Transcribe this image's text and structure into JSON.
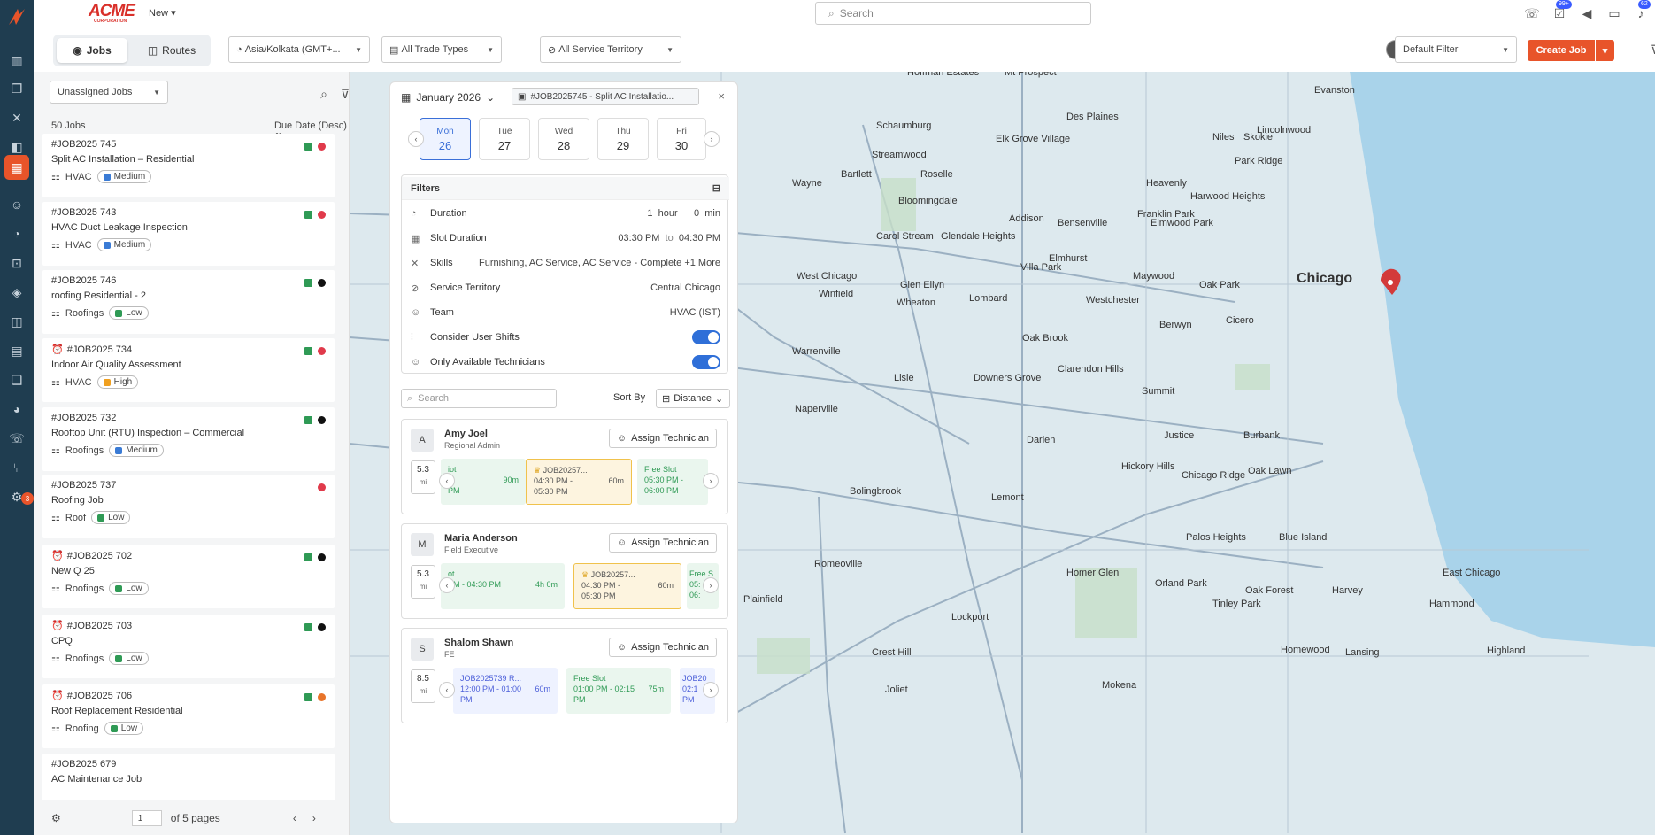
{
  "header": {
    "brand": "ACME",
    "brand_sub": "CORPORATION",
    "new_label": "New",
    "search_placeholder": "Search",
    "badges": {
      "tasks": "99+",
      "notif": "62"
    }
  },
  "toolbar": {
    "tab_jobs": "Jobs",
    "tab_routes": "Routes",
    "timezone": "Asia/Kolkata (GMT+...",
    "trade_types": "All Trade Types",
    "territory": "All Service Territory",
    "filter": "Default Filter",
    "create_job": "Create Job"
  },
  "sidebar_badge": "3",
  "jobs": {
    "selector": "Unassigned Jobs",
    "count": "50 Jobs",
    "sort": "Due Date (Desc)",
    "items": [
      {
        "id": "#JOB2025 745",
        "title": "Split AC Installation – Residential",
        "trade": "HVAC",
        "priority": "Medium",
        "pcolor": "#3a7bd5",
        "alarm": false,
        "d1": "#2f9a55",
        "d2": "#e03a4b"
      },
      {
        "id": "#JOB2025 743",
        "title": "HVAC Duct Leakage Inspection",
        "trade": "HVAC",
        "priority": "Medium",
        "pcolor": "#3a7bd5",
        "alarm": false,
        "d1": "#2f9a55",
        "d2": "#e03a4b"
      },
      {
        "id": "#JOB2025 746",
        "title": "roofing Residential - 2",
        "trade": "Roofings",
        "priority": "Low",
        "pcolor": "#2f9a55",
        "alarm": false,
        "d1": "#2f9a55",
        "d2": "#111"
      },
      {
        "id": "#JOB2025 734",
        "title": "Indoor Air Quality Assessment",
        "trade": "HVAC",
        "priority": "High",
        "pcolor": "#f0a020",
        "alarm": true,
        "d1": "#2f9a55",
        "d2": "#e03a4b"
      },
      {
        "id": "#JOB2025 732",
        "title": "Rooftop Unit (RTU) Inspection – Commercial",
        "trade": "Roofings",
        "priority": "Medium",
        "pcolor": "#3a7bd5",
        "alarm": false,
        "d1": "#2f9a55",
        "d2": "#111"
      },
      {
        "id": "#JOB2025 737",
        "title": "Roofing Job",
        "trade": "Roof",
        "priority": "Low",
        "pcolor": "#2f9a55",
        "alarm": false,
        "d1": "",
        "d2": "#e03a4b"
      },
      {
        "id": "#JOB2025 702",
        "title": "New Q 25",
        "trade": "Roofings",
        "priority": "Low",
        "pcolor": "#2f9a55",
        "alarm": true,
        "d1": "#2f9a55",
        "d2": "#111"
      },
      {
        "id": "#JOB2025 703",
        "title": "CPQ",
        "trade": "Roofings",
        "priority": "Low",
        "pcolor": "#2f9a55",
        "alarm": true,
        "d1": "#2f9a55",
        "d2": "#111"
      },
      {
        "id": "#JOB2025 706",
        "title": "Roof Replacement Residential",
        "trade": "Roofing",
        "priority": "Low",
        "pcolor": "#2f9a55",
        "alarm": true,
        "d1": "#2f9a55",
        "d2": "#e8742a"
      },
      {
        "id": "#JOB2025 679",
        "title": "AC Maintenance Job",
        "trade": "",
        "priority": "",
        "pcolor": "",
        "alarm": false,
        "d1": "",
        "d2": ""
      }
    ],
    "page": "1",
    "pages_label": "of 5 pages"
  },
  "panel": {
    "month": "January 2026",
    "job_chip": "#JOB2025745 - Split AC Installatio...",
    "days": [
      {
        "d": "Mon",
        "n": "26"
      },
      {
        "d": "Tue",
        "n": "27"
      },
      {
        "d": "Wed",
        "n": "28"
      },
      {
        "d": "Thu",
        "n": "29"
      },
      {
        "d": "Fri",
        "n": "30"
      }
    ],
    "filters_title": "Filters",
    "duration_label": "Duration",
    "duration_h": "1",
    "hour": "hour",
    "duration_m": "0",
    "min": "min",
    "slot_label": "Slot Duration",
    "slot_from": "03:30 PM",
    "to": "to",
    "slot_to": "04:30 PM",
    "skills_label": "Skills",
    "skills": "Furnishing, AC Service, AC Service - Complete +1 More",
    "territory_label": "Service Territory",
    "territory": "Central Chicago",
    "team_label": "Team",
    "team": "HVAC (IST)",
    "shifts_label": "Consider User Shifts",
    "avail_label": "Only Available Technicians",
    "search_placeholder": "Search",
    "sortby": "Sort By",
    "sort_value": "Distance",
    "assign": "Assign Technician",
    "techs": [
      {
        "ini": "A",
        "name": "Amy Joel",
        "role": "Regional Admin",
        "dist": "5.3",
        "unit": "mi"
      },
      {
        "ini": "M",
        "name": "Maria Anderson",
        "role": "Field Executive",
        "dist": "5.3",
        "unit": "mi"
      },
      {
        "ini": "S",
        "name": "Shalom Shawn",
        "role": "FE",
        "dist": "8.5",
        "unit": "mi"
      }
    ]
  },
  "map": {
    "labels": [
      "Evanston",
      "Skokie",
      "Niles",
      "Des Plaines",
      "Mt Prospect",
      "Hoffman Estates",
      "Schaumburg",
      "Elk Grove Village",
      "Park Ridge",
      "Lincolnwood",
      "Streamwood",
      "Bartlett",
      "Roselle",
      "Wayne",
      "Bloomingdale",
      "Addison",
      "Bensenville",
      "Franklin Park",
      "Elmwood Park",
      "Heavenly",
      "Harwood Heights",
      "Carol Stream",
      "Glendale Heights",
      "Elmhurst",
      "Maywood",
      "Oak Park",
      "Chicago",
      "West Chicago",
      "Winfield",
      "Glen Ellyn",
      "Lombard",
      "Villa Park",
      "Wheaton",
      "Berwyn",
      "Cicero",
      "Westchester",
      "Warrenville",
      "Oak Brook",
      "Lisle",
      "Downers Grove",
      "Clarendon Hills",
      "Summit",
      "Naperville",
      "Darien",
      "Justice",
      "Burbank",
      "Bolingbrook",
      "Hickory Hills",
      "Chicago Ridge",
      "Oak Lawn",
      "Romeoville",
      "Palos Heights",
      "Blue Island",
      "Homer Glen",
      "Orland Park",
      "Oak Forest",
      "Harvey",
      "Tinley Park",
      "Plainfield",
      "Lockport",
      "Crest Hill",
      "Joliet",
      "Hammond",
      "East Chicago",
      "Highland",
      "Mokena",
      "Homewood",
      "Lansing",
      "Lemont"
    ]
  }
}
